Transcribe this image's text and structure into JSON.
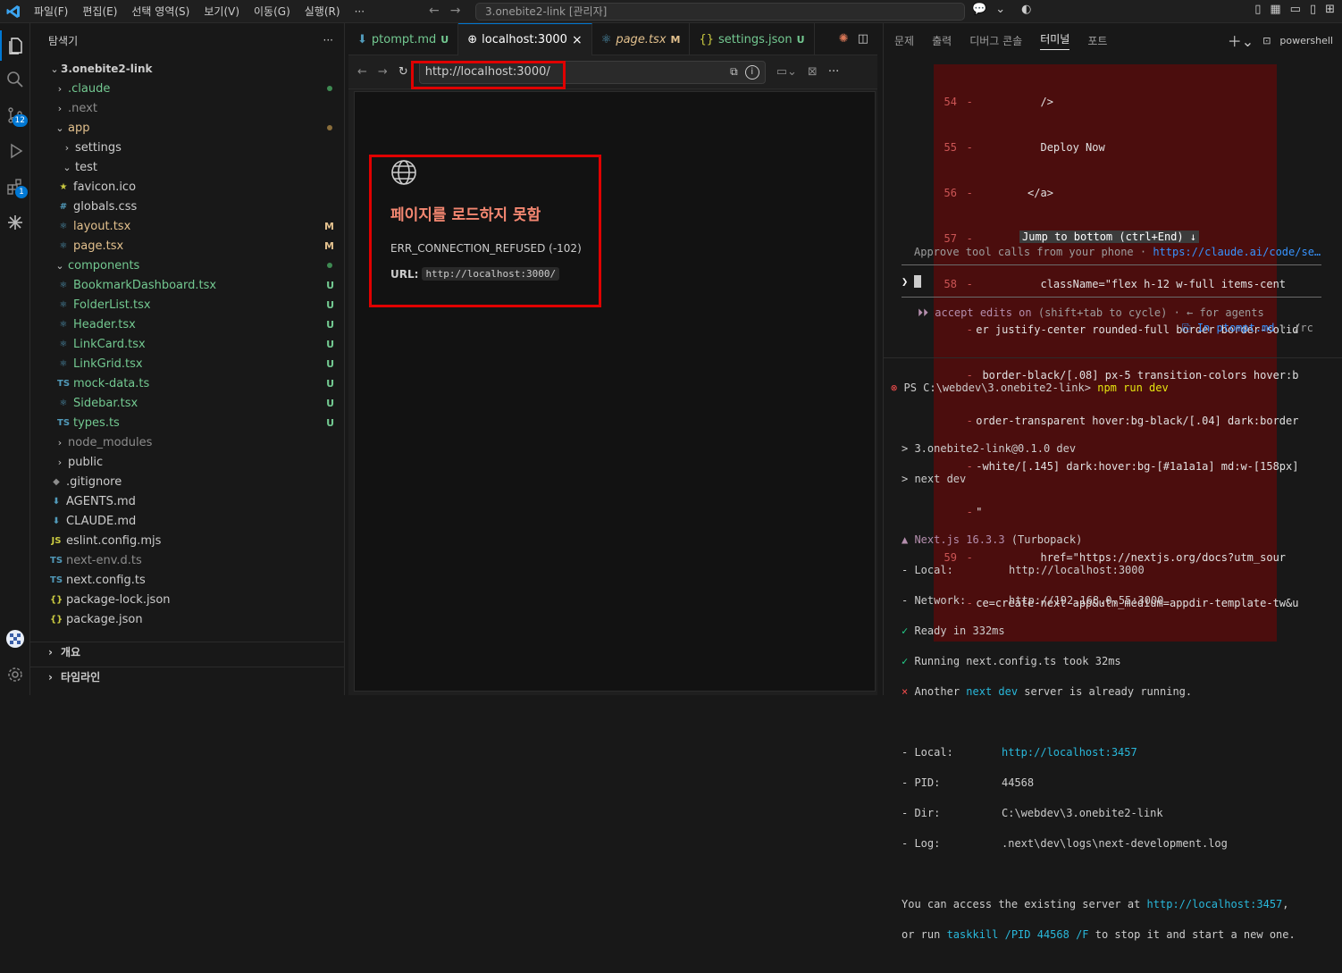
{
  "titlebar": {
    "menu": [
      "파일(F)",
      "편집(E)",
      "선택 영역(S)",
      "보기(V)",
      "이동(G)",
      "실행(R)",
      "···"
    ],
    "command_center": "3.onebite2-link [관리자]"
  },
  "activity": {
    "scm_badge": "12",
    "ext_badge": "1"
  },
  "sidebar": {
    "title": "탐색기",
    "more": "···",
    "root": "3.onebite2-link",
    "items": [
      {
        "label": ".claude",
        "status": "dot"
      },
      {
        "label": ".next",
        "status": ""
      },
      {
        "label": "app",
        "status": "dot"
      },
      {
        "label": "settings",
        "status": ""
      },
      {
        "label": "test",
        "status": ""
      },
      {
        "label": "favicon.ico",
        "status": ""
      },
      {
        "label": "globals.css",
        "status": ""
      },
      {
        "label": "layout.tsx",
        "status": "M"
      },
      {
        "label": "page.tsx",
        "status": "M"
      },
      {
        "label": "components",
        "status": "dot"
      },
      {
        "label": "BookmarkDashboard.tsx",
        "status": "U"
      },
      {
        "label": "FolderList.tsx",
        "status": "U"
      },
      {
        "label": "Header.tsx",
        "status": "U"
      },
      {
        "label": "LinkCard.tsx",
        "status": "U"
      },
      {
        "label": "LinkGrid.tsx",
        "status": "U"
      },
      {
        "label": "mock-data.ts",
        "status": "U"
      },
      {
        "label": "Sidebar.tsx",
        "status": "U"
      },
      {
        "label": "types.ts",
        "status": "U"
      },
      {
        "label": "node_modules",
        "status": ""
      },
      {
        "label": "public",
        "status": ""
      },
      {
        "label": ".gitignore",
        "status": ""
      },
      {
        "label": "AGENTS.md",
        "status": ""
      },
      {
        "label": "CLAUDE.md",
        "status": ""
      },
      {
        "label": "eslint.config.mjs",
        "status": ""
      },
      {
        "label": "next-env.d.ts",
        "status": ""
      },
      {
        "label": "next.config.ts",
        "status": ""
      },
      {
        "label": "package-lock.json",
        "status": ""
      },
      {
        "label": "package.json",
        "status": ""
      }
    ],
    "outline": "개요",
    "timeline": "타임라인"
  },
  "editor": {
    "tabs": [
      {
        "label": "ptompt.md",
        "mark": "U"
      },
      {
        "label": "localhost:3000",
        "mark": "×"
      },
      {
        "label": "page.tsx",
        "mark": "M"
      },
      {
        "label": "settings.json",
        "mark": "U"
      }
    ],
    "url": "http://localhost:3000/",
    "error": {
      "title": "페이지를 로드하지 못함",
      "code": "ERR_CONNECTION_REFUSED (-102)",
      "url_label": "URL:",
      "url": "http://localhost:3000/"
    }
  },
  "panel": {
    "tabs": [
      "문제",
      "출력",
      "디버그 콘솔",
      "터미널",
      "포트"
    ],
    "shell": "powershell",
    "diff_lines": [
      {
        "n": "54",
        "m": "-",
        "t": "          />"
      },
      {
        "n": "55",
        "m": "-",
        "t": "          Deploy Now"
      },
      {
        "n": "56",
        "m": "-",
        "t": "        </a>"
      },
      {
        "n": "57",
        "m": "-",
        "t": "        <a"
      },
      {
        "n": "58",
        "m": "-",
        "t": "          className=\"flex h-12 w-full items-cent"
      },
      {
        "n": "",
        "m": "-",
        "t": "er justify-center rounded-full border border-solid"
      },
      {
        "n": "",
        "m": "-",
        "t": " border-black/[.08] px-5 transition-colors hover:b"
      },
      {
        "n": "",
        "m": "-",
        "t": "order-transparent hover:bg-black/[.04] dark:border"
      },
      {
        "n": "",
        "m": "-",
        "t": "-white/[.145] dark:hover:bg-[#1a1a1a] md:w-[158px]"
      },
      {
        "n": "",
        "m": "-",
        "t": "\""
      },
      {
        "n": "59",
        "m": "-",
        "t": "          href=\"https://nextjs.org/docs?utm_sour"
      },
      {
        "n": "",
        "m": "-",
        "t": "ce=create-next-app&utm_medium=appdir-template-tw&u"
      }
    ],
    "jump": "Jump to bottom (ctrl+End) ↓",
    "approve_text": "Approve tool calls from your phone · ",
    "approve_link": "https://claude.ai/code/se…",
    "prompt": "❯",
    "accept_icon": "⏵⏵",
    "accept_edits": "accept edits on",
    "accept_rest": " (shift+tab to cycle) · ← for agents",
    "in_file": "⎘ In ptompt.md",
    "rc": " · /rc",
    "ps_prompt": "PS C:\\webdev\\3.onebite2-link>",
    "ps_cmd": "npm run dev",
    "out1": "> 3.onebite2-link@0.1.0 dev",
    "out2": "> next dev",
    "next_label": "▲ Next.js 16.3.3",
    "next_turbo": " (Turbopack)",
    "local1_k": "- Local:",
    "local1_v": "http://localhost:3000",
    "network_k": "- Network:",
    "network_v": "http://192.168.0.55:3000",
    "ready": "Ready in 332ms",
    "running": "Running next.config.ts took 32ms",
    "another1": "Another ",
    "another2": "next dev",
    "another3": " server is already running.",
    "local2_k": "- Local:",
    "local2_v": "http://localhost:3457",
    "pid_k": "- PID:",
    "pid_v": "44568",
    "dir_k": "- Dir:",
    "dir_v": "C:\\webdev\\3.onebite2-link",
    "log_k": "- Log:",
    "log_v": ".next\\dev\\logs\\next-development.log",
    "access1": "You can access the existing server at ",
    "access_link": "http://localhost:3457",
    "access2": ",",
    "run1": "or run ",
    "run_cmd": "taskkill",
    "run_args": " /PID 44568 /F",
    "run2": " to stop it and start a new one."
  }
}
